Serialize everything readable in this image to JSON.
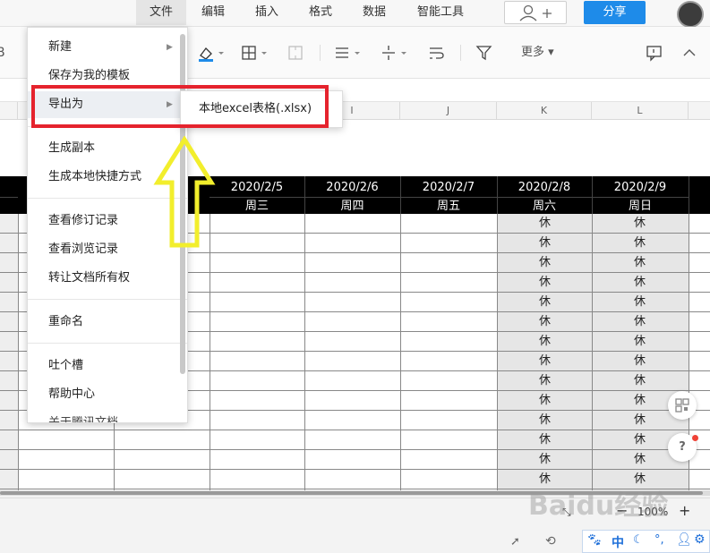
{
  "menubar": {
    "items": [
      "文件",
      "编辑",
      "插入",
      "格式",
      "数据",
      "智能工具"
    ],
    "share_label": "分享"
  },
  "toolbar": {
    "more_label": "更多"
  },
  "columns": [
    "I",
    "J",
    "K",
    "L"
  ],
  "sheet": {
    "dates": [
      "2020/2/5",
      "2020/2/6",
      "2020/2/7",
      "2020/2/8",
      "2020/2/9"
    ],
    "weekdays": [
      "周三",
      "周四",
      "周五",
      "周六",
      "周日"
    ],
    "rest_label": "休"
  },
  "file_menu": {
    "items": [
      "新建",
      "保存为我的模板",
      "导出为",
      "生成副本",
      "生成本地快捷方式",
      "查看修订记录",
      "查看浏览记录",
      "转让文档所有权",
      "重命名",
      "吐个槽",
      "帮助中心"
    ],
    "partial_last": "关于腾讯文档"
  },
  "export_submenu": {
    "item": "本地excel表格(.xlsx)"
  },
  "status": {
    "zoom": "100%",
    "ime_label": "中"
  },
  "colors": {
    "highlight_box": "#e5232d",
    "annotation_arrow": "#f2ee2c",
    "share_button": "#1e8be9",
    "header_row": "#000000",
    "weekend_fill": "#e6e6e6"
  },
  "watermark": "Baidu经验"
}
